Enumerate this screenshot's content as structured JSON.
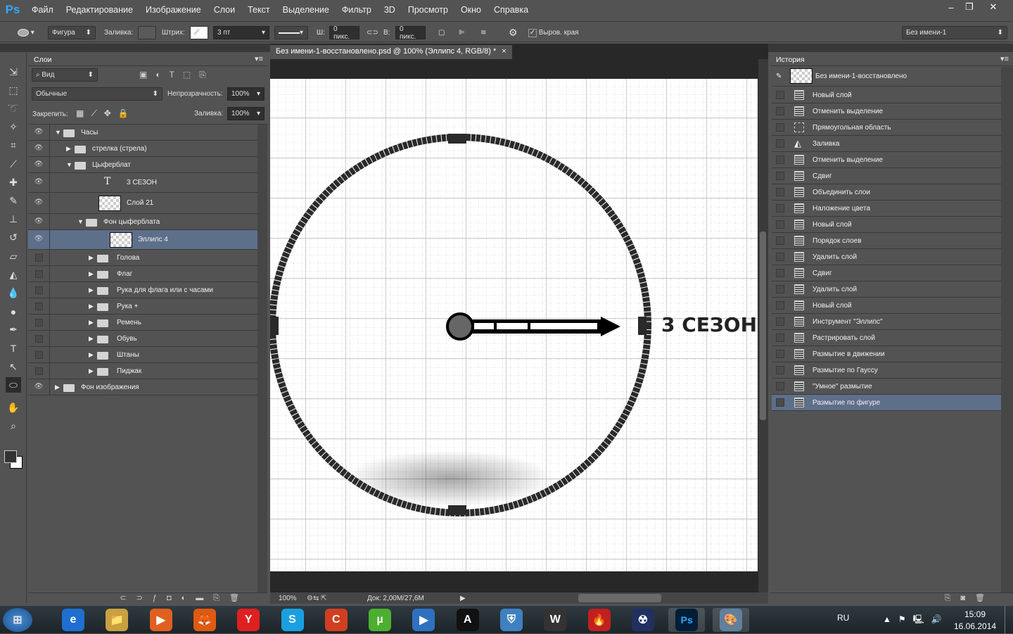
{
  "app": {
    "logo": "Ps",
    "menu": [
      "Файл",
      "Редактирование",
      "Изображение",
      "Слои",
      "Текст",
      "Выделение",
      "Фильтр",
      "3D",
      "Просмотр",
      "Окно",
      "Справка"
    ]
  },
  "options": {
    "mode": "Фигура",
    "fill_label": "Заливка:",
    "stroke_label": "Штрих:",
    "stroke_width": "3 пт",
    "w_label": "Ш:",
    "w_value": "0 пикс.",
    "h_label": "В:",
    "h_value": "0 пикс.",
    "align_edges": "Выров. края",
    "align_edges_checked": true,
    "preset": "Без имени-1"
  },
  "document": {
    "tab_title": "Без имени-1-восстановлено.psd @ 100% (Эллипс 4, RGB/8) *",
    "close": "×",
    "canvas_text": "3 СЕЗОН",
    "zoom": "100%",
    "doc_info": "Док: 2,00M/27,6M"
  },
  "layers": {
    "tab": "Слои",
    "filter": "Вид",
    "blend": "Обычные",
    "opacity_label": "Непрозрачность:",
    "opacity": "100%",
    "lock_label": "Закрепить:",
    "fill_label": "Заливка:",
    "fill": "100%",
    "items": [
      {
        "name": "Часы",
        "type": "group",
        "open": true,
        "visible": true,
        "indent": 0
      },
      {
        "name": "стрелка (стрела)",
        "type": "group",
        "open": false,
        "visible": true,
        "indent": 1
      },
      {
        "name": "Цыферблат",
        "type": "group",
        "open": true,
        "visible": true,
        "indent": 1
      },
      {
        "name": "3 СЕЗОН",
        "type": "text",
        "visible": true,
        "indent": 2
      },
      {
        "name": "Слой 21",
        "type": "pixel",
        "visible": true,
        "indent": 2
      },
      {
        "name": "Фон цыферблата",
        "type": "group",
        "open": true,
        "visible": true,
        "indent": 2
      },
      {
        "name": "Эллипс 4",
        "type": "pixel",
        "visible": true,
        "selected": true,
        "indent": 3
      },
      {
        "name": "Голова",
        "type": "group",
        "open": false,
        "visible": false,
        "indent": 3
      },
      {
        "name": "Флаг",
        "type": "group",
        "open": false,
        "visible": false,
        "indent": 3
      },
      {
        "name": "Рука для флага или с часами",
        "type": "group",
        "open": false,
        "visible": false,
        "indent": 3
      },
      {
        "name": "Рука +",
        "type": "group",
        "open": false,
        "visible": false,
        "indent": 3
      },
      {
        "name": "Ремень",
        "type": "group",
        "open": false,
        "visible": false,
        "indent": 3
      },
      {
        "name": "Обувь",
        "type": "group",
        "open": false,
        "visible": false,
        "indent": 3
      },
      {
        "name": "Штаны",
        "type": "group",
        "open": false,
        "visible": false,
        "indent": 3
      },
      {
        "name": "Пиджак",
        "type": "group",
        "open": false,
        "visible": false,
        "indent": 3
      },
      {
        "name": "Фон изображения",
        "type": "group",
        "open": false,
        "visible": true,
        "indent": 0
      }
    ]
  },
  "history": {
    "tab": "История",
    "snapshot": "Без имени-1-восстановлено",
    "items": [
      "Новый слой",
      "Отменить выделение",
      "Прямоугольная область",
      "Заливка",
      "Отменить выделение",
      "Сдвиг",
      "Объединить слои",
      "Наложение цвета",
      "Новый слой",
      "Порядок слоев",
      "Удалить слой",
      "Сдвиг",
      "Удалить слой",
      "Новый слой",
      "Инструмент \"Эллипс\"",
      "Растрировать слой",
      "Размытие в движении",
      "Размытие по Гауссу",
      "\"Умное\" размытие",
      "Размытие по фигуре"
    ],
    "selected_index": 19
  },
  "taskbar": {
    "lang": "RU",
    "time": "15:09",
    "date": "16.06.2014",
    "start_icon": "windows-start-icon",
    "pinned": [
      "ie",
      "explorer",
      "media-player",
      "firefox",
      "yandex",
      "skype",
      "ccleaner",
      "utorrent",
      "media-center",
      "arma",
      "windows-update",
      "world-of-tanks",
      "flame-app",
      "stalker",
      "photoshop",
      "paint"
    ]
  },
  "colors": {
    "accent": "#31a8ff",
    "panel": "#535353",
    "selected_row": "#5e6f8a",
    "canvas_stroke": "#2a2a2a"
  }
}
